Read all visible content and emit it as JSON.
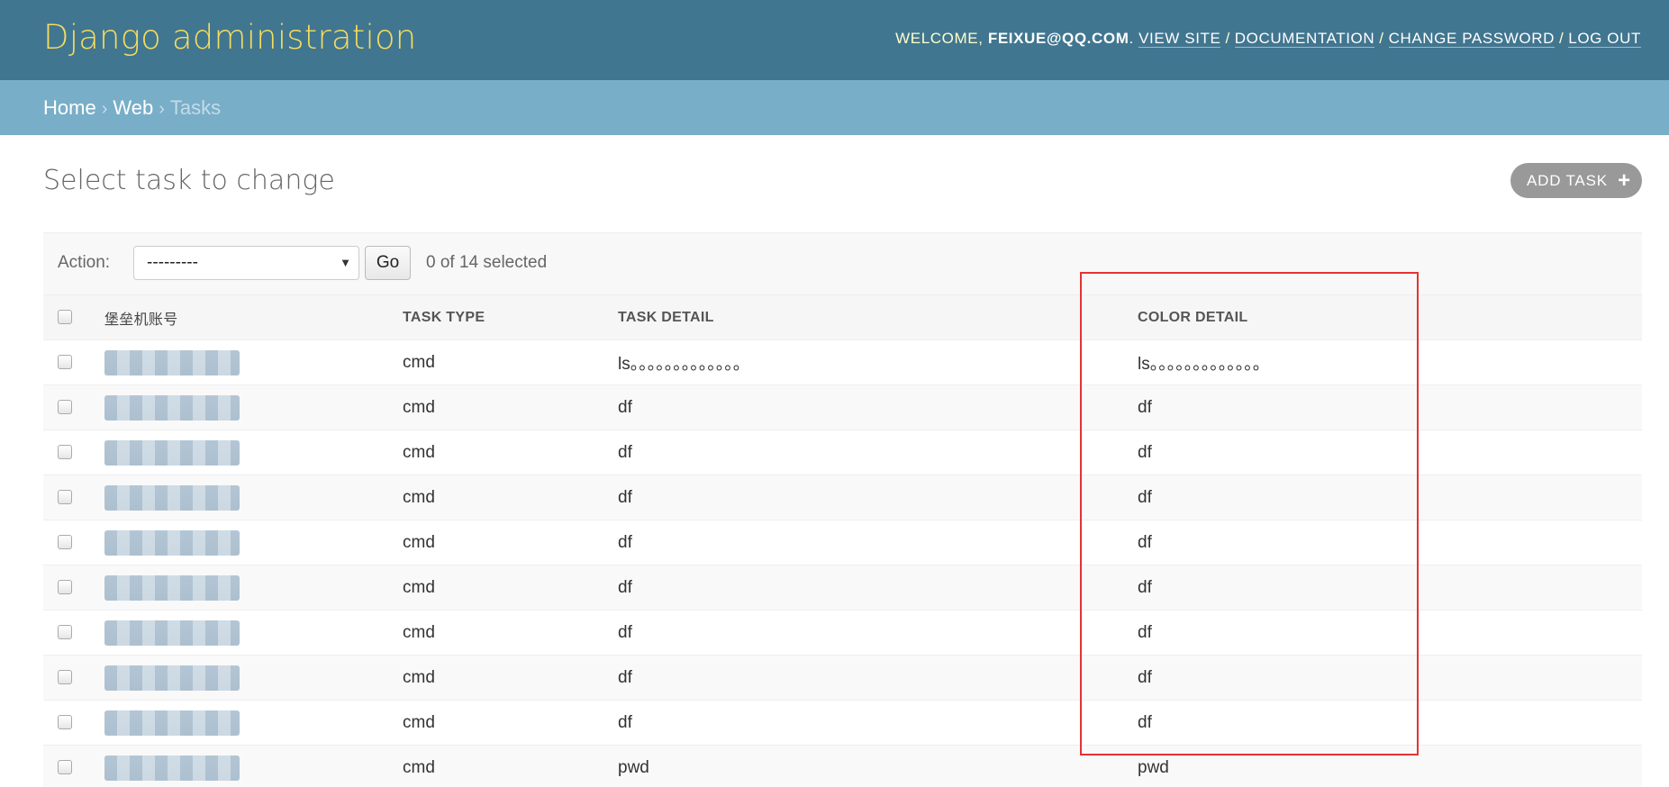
{
  "header": {
    "site_name": "Django administration",
    "welcome": "WELCOME, ",
    "username": "FEIXUE@QQ.COM",
    "username_suffix": ".",
    "links": [
      "VIEW SITE",
      "DOCUMENTATION",
      "CHANGE PASSWORD",
      "LOG OUT"
    ],
    "separator": "/"
  },
  "breadcrumbs": {
    "items": [
      "Home",
      "Web"
    ],
    "current": "Tasks",
    "arrow": "›"
  },
  "page": {
    "title": "Select task to change",
    "add_button": "ADD TASK",
    "add_icon": "plus-icon"
  },
  "actions": {
    "label": "Action:",
    "select_value": "---------",
    "go_label": "Go",
    "selected_text": "0 of 14 selected"
  },
  "table": {
    "headers": [
      "堡垒机账号",
      "TASK TYPE",
      "TASK DETAIL",
      "COLOR DETAIL"
    ],
    "rows": [
      {
        "type": "cmd",
        "detail": "ls。。。。。。。。。。。。。",
        "color": "ls。。。。。。。。。。。。。"
      },
      {
        "type": "cmd",
        "detail": "df",
        "color": "df"
      },
      {
        "type": "cmd",
        "detail": "df",
        "color": "df"
      },
      {
        "type": "cmd",
        "detail": "df",
        "color": "df"
      },
      {
        "type": "cmd",
        "detail": "df",
        "color": "df"
      },
      {
        "type": "cmd",
        "detail": "df",
        "color": "df"
      },
      {
        "type": "cmd",
        "detail": "df",
        "color": "df"
      },
      {
        "type": "cmd",
        "detail": "df",
        "color": "df"
      },
      {
        "type": "cmd",
        "detail": "df",
        "color": "df"
      },
      {
        "type": "cmd",
        "detail": "pwd",
        "color": "pwd"
      }
    ]
  },
  "colors": {
    "header_bg": "#417690",
    "breadcrumb_bg": "#79aec8",
    "brand": "#f5dd5d",
    "detail_red": "#e00000",
    "highlight": "#e53333"
  }
}
